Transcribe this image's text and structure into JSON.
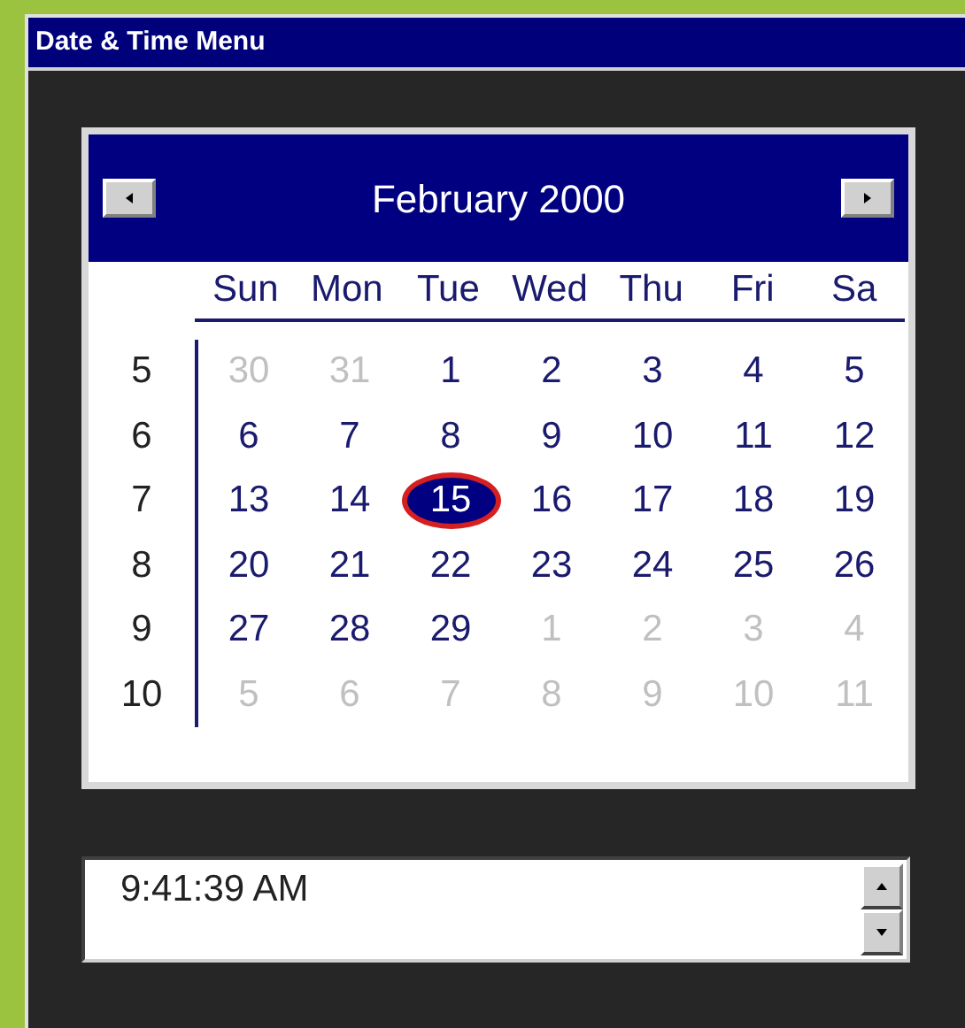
{
  "window": {
    "title": "Date & Time Menu"
  },
  "calendar": {
    "month": "February 2000",
    "weekdays": [
      "Sun",
      "Mon",
      "Tue",
      "Wed",
      "Thu",
      "Fri",
      "Sa"
    ],
    "weeks": [
      {
        "number": "5",
        "days": [
          {
            "label": "30",
            "muted": true,
            "selected": false
          },
          {
            "label": "31",
            "muted": true,
            "selected": false
          },
          {
            "label": "1",
            "muted": false,
            "selected": false
          },
          {
            "label": "2",
            "muted": false,
            "selected": false
          },
          {
            "label": "3",
            "muted": false,
            "selected": false
          },
          {
            "label": "4",
            "muted": false,
            "selected": false
          },
          {
            "label": "5",
            "muted": false,
            "selected": false
          }
        ]
      },
      {
        "number": "6",
        "days": [
          {
            "label": "6",
            "muted": false,
            "selected": false
          },
          {
            "label": "7",
            "muted": false,
            "selected": false
          },
          {
            "label": "8",
            "muted": false,
            "selected": false
          },
          {
            "label": "9",
            "muted": false,
            "selected": false
          },
          {
            "label": "10",
            "muted": false,
            "selected": false
          },
          {
            "label": "11",
            "muted": false,
            "selected": false
          },
          {
            "label": "12",
            "muted": false,
            "selected": false
          }
        ]
      },
      {
        "number": "7",
        "days": [
          {
            "label": "13",
            "muted": false,
            "selected": false
          },
          {
            "label": "14",
            "muted": false,
            "selected": false
          },
          {
            "label": "15",
            "muted": false,
            "selected": true
          },
          {
            "label": "16",
            "muted": false,
            "selected": false
          },
          {
            "label": "17",
            "muted": false,
            "selected": false
          },
          {
            "label": "18",
            "muted": false,
            "selected": false
          },
          {
            "label": "19",
            "muted": false,
            "selected": false
          }
        ]
      },
      {
        "number": "8",
        "days": [
          {
            "label": "20",
            "muted": false,
            "selected": false
          },
          {
            "label": "21",
            "muted": false,
            "selected": false
          },
          {
            "label": "22",
            "muted": false,
            "selected": false
          },
          {
            "label": "23",
            "muted": false,
            "selected": false
          },
          {
            "label": "24",
            "muted": false,
            "selected": false
          },
          {
            "label": "25",
            "muted": false,
            "selected": false
          },
          {
            "label": "26",
            "muted": false,
            "selected": false
          }
        ]
      },
      {
        "number": "9",
        "days": [
          {
            "label": "27",
            "muted": false,
            "selected": false
          },
          {
            "label": "28",
            "muted": false,
            "selected": false
          },
          {
            "label": "29",
            "muted": false,
            "selected": false
          },
          {
            "label": "1",
            "muted": true,
            "selected": false
          },
          {
            "label": "2",
            "muted": true,
            "selected": false
          },
          {
            "label": "3",
            "muted": true,
            "selected": false
          },
          {
            "label": "4",
            "muted": true,
            "selected": false
          }
        ]
      },
      {
        "number": "10",
        "days": [
          {
            "label": "5",
            "muted": true,
            "selected": false
          },
          {
            "label": "6",
            "muted": true,
            "selected": false
          },
          {
            "label": "7",
            "muted": true,
            "selected": false
          },
          {
            "label": "8",
            "muted": true,
            "selected": false
          },
          {
            "label": "9",
            "muted": true,
            "selected": false
          },
          {
            "label": "10",
            "muted": true,
            "selected": false
          },
          {
            "label": "11",
            "muted": true,
            "selected": false
          }
        ]
      }
    ]
  },
  "time": {
    "value": "9:41:39 AM"
  }
}
